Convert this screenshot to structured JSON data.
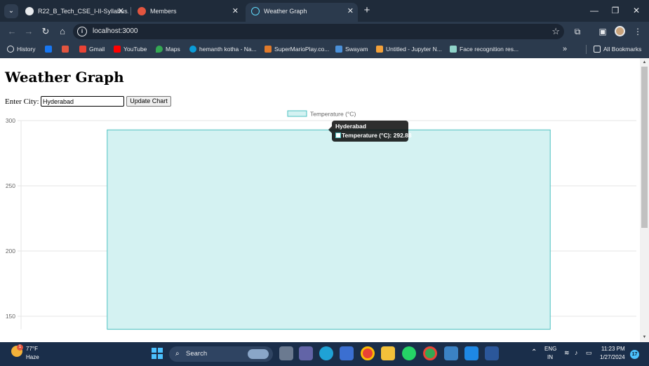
{
  "browser": {
    "tabs": [
      {
        "label": "R22_B_Tech_CSE_I-II-Syllabus.p",
        "active": false
      },
      {
        "label": "Members",
        "active": false
      },
      {
        "label": "Weather Graph",
        "active": true
      }
    ],
    "url": "localhost:3000",
    "bookmarks": [
      "History",
      "Gmail",
      "YouTube",
      "Maps",
      "hemanth kotha - Na...",
      "SuperMarioPlay.co...",
      "Swayam",
      "Untitled - Jupyter N...",
      "Face recognition res..."
    ],
    "all_bookmarks_label": "All Bookmarks",
    "overflow_label": "»"
  },
  "page": {
    "title": "Weather Graph",
    "city_label": "Enter City:",
    "city_value": "Hyderabad",
    "update_button_label": "Update Chart"
  },
  "chart_data": {
    "type": "bar",
    "categories": [
      "Hyderabad"
    ],
    "series": [
      {
        "name": "Temperature (°C)",
        "values": [
          292.88
        ]
      }
    ],
    "ylim": [
      140,
      300
    ],
    "yticks": [
      150,
      200,
      250,
      300
    ],
    "colors": {
      "fill": "#d4f2f2",
      "stroke": "#4bc0c0"
    },
    "grid": true,
    "legend": "top-center",
    "tooltip": {
      "title": "Hyderabad",
      "body": "Temperature (°C): 292.88"
    }
  },
  "taskbar": {
    "weather_temp": "77°F",
    "weather_condition": "Haze",
    "search_label": "Search",
    "lang_primary": "ENG",
    "lang_secondary": "IN",
    "time": "11:23 PM",
    "date": "1/27/2024",
    "notification_count": "17",
    "weather_badge": "1"
  },
  "colors": {
    "tab_strip": "#1f2b3a",
    "toolbar": "#2b3a4d",
    "taskbar": "#1a2e4a",
    "accent": "#4bc0c0"
  }
}
